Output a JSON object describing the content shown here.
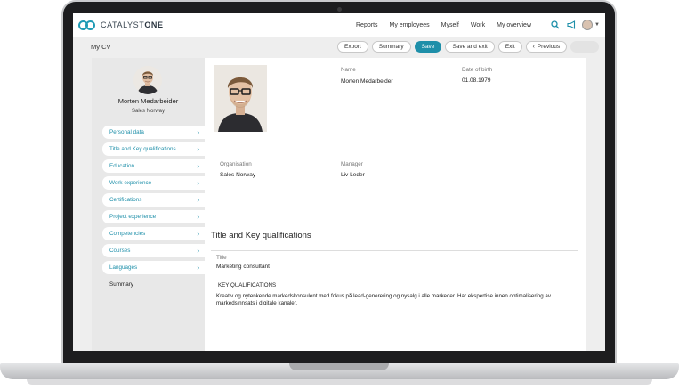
{
  "app": {
    "brand_light": "CATALYST",
    "brand_bold": "ONE",
    "accent_color": "#1e8fa9"
  },
  "topnav": {
    "links": [
      "Reports",
      "My employees",
      "Myself",
      "Work",
      "My overview"
    ],
    "icons": [
      "search-icon",
      "megaphone-icon",
      "avatar",
      "chevron-down-icon"
    ]
  },
  "titlebar": {
    "page_title": "My CV",
    "buttons": {
      "export": "Export",
      "summary": "Summary",
      "save": "Save",
      "save_exit": "Save and exit",
      "exit": "Exit",
      "previous": "Previous"
    },
    "previous_icon": "chevron-left-icon"
  },
  "profile": {
    "name": "Morten Medarbeider",
    "department": "Sales Norway"
  },
  "sidebar": {
    "items": [
      {
        "label": "Personal data"
      },
      {
        "label": "Title and Key qualifications"
      },
      {
        "label": "Education"
      },
      {
        "label": "Work experience"
      },
      {
        "label": "Certifications"
      },
      {
        "label": "Project experience"
      },
      {
        "label": "Competencies"
      },
      {
        "label": "Courses"
      },
      {
        "label": "Languages"
      },
      {
        "label": "Summary"
      }
    ]
  },
  "personal": {
    "name_label": "Name",
    "name_value": "Morten Medarbeider",
    "dob_label": "Date of birth",
    "dob_value": "01.08.1979",
    "org_label": "Organisation",
    "org_value": "Sales Norway",
    "manager_label": "Manager",
    "manager_value": "Liv Leder"
  },
  "qualifications": {
    "section_title": "Title and Key qualifications",
    "title_label": "Title",
    "title_value": "Marketing consultant",
    "key_label": "KEY QUALIFICATIONS",
    "key_text": "Kreativ og nytenkende markedskonsulent med fokus på lead-generering og nysalg i alle markeder. Har ekspertise innen optimalisering av markedsinnsats i digitale kanaler."
  }
}
